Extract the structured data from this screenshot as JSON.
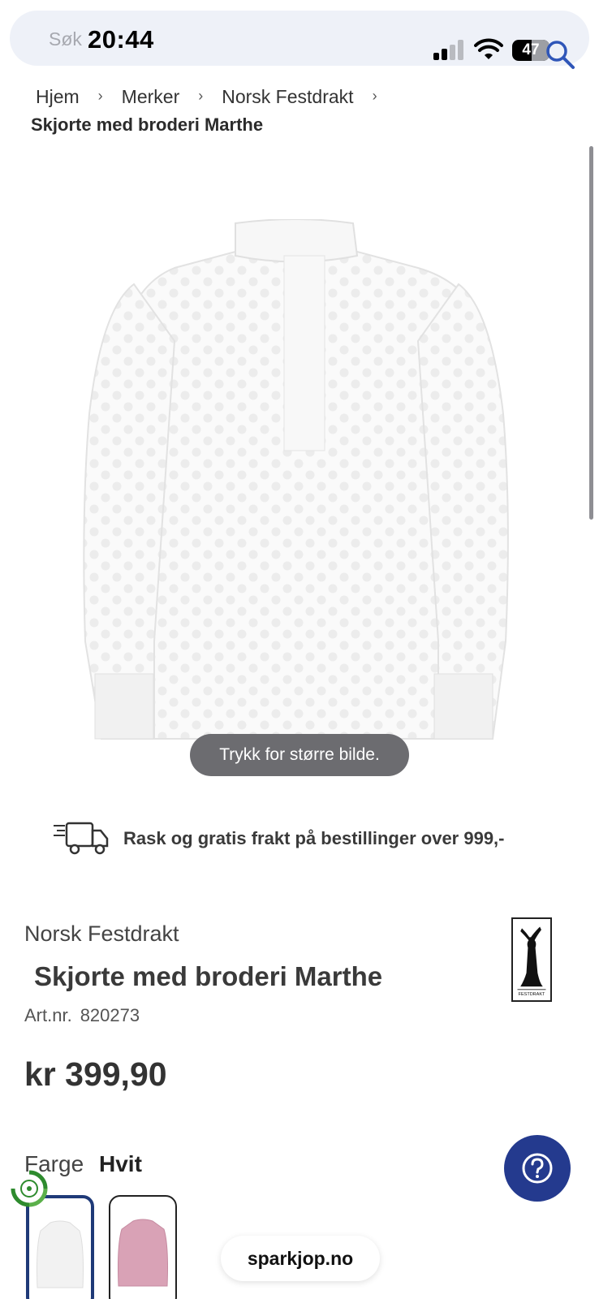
{
  "status_bar": {
    "time": "20:44",
    "battery": "47"
  },
  "search": {
    "placeholder": "Søk"
  },
  "breadcrumb": {
    "items": [
      {
        "label": "Hjem"
      },
      {
        "label": "Merker"
      },
      {
        "label": "Norsk Festdrakt"
      }
    ],
    "current": "Skjorte med broderi Marthe"
  },
  "product": {
    "image_hint": "Trykk for større bilde.",
    "shipping_text": "Rask og gratis frakt på bestillinger over 999,-",
    "brand": "Norsk Festdrakt",
    "name": "Skjorte med broderi Marthe",
    "art_label": "Art.nr.",
    "art_number": "820273",
    "price": "kr 399,90",
    "color_label": "Farge",
    "color_value": "Hvit",
    "swatches": [
      {
        "name": "white",
        "color": "#f4f4f4",
        "selected": true
      },
      {
        "name": "pink",
        "color": "#d9a2b6",
        "selected": false
      }
    ],
    "brand_logo_text": "FESTDRAKT"
  },
  "help": {
    "icon": "question-icon"
  },
  "browser": {
    "url": "sparkjop.no"
  },
  "colors": {
    "accent": "#243a8e",
    "selected_border": "#1f3a78",
    "eco_green": "#2e8b2e"
  }
}
